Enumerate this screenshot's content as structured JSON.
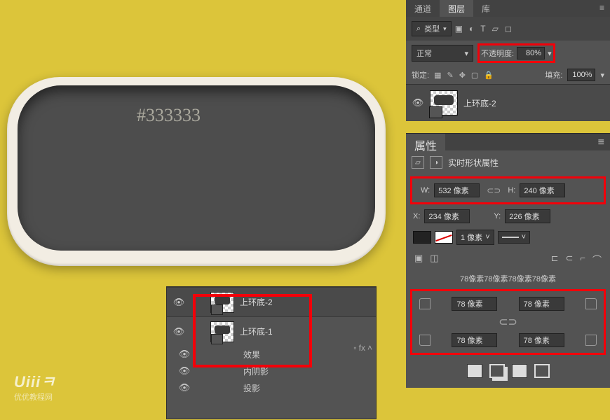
{
  "canvas": {
    "hex": "#333333"
  },
  "watermark": {
    "logo": "Uiiiㅋ",
    "sub": "优优教程网"
  },
  "layers_panel": {
    "tabs": {
      "channels": "通道",
      "layers": "图层",
      "libraries": "库"
    },
    "filter": {
      "label": "类型"
    },
    "blend": {
      "mode": "正常",
      "opacity_label": "不透明度:",
      "opacity_value": "80%"
    },
    "lock": {
      "label": "锁定:",
      "fill_label": "填充:",
      "fill_value": "100%"
    },
    "layer": {
      "name": "上环底-2"
    }
  },
  "layers_mini": {
    "row1": "上环底-2",
    "row2": "上环底-1",
    "sub_effects": "效果",
    "sub_inner": "内阴影",
    "sub_drop": "投影"
  },
  "properties": {
    "tab": "属性",
    "title": "实时形状属性",
    "w_label": "W:",
    "w_value": "532 像素",
    "h_label": "H:",
    "h_value": "240 像素",
    "x_label": "X:",
    "x_value": "234 像素",
    "y_label": "Y:",
    "y_value": "226 像素",
    "stroke_width": "1 像素",
    "radius_summary": "78像素78像素78像素78像素",
    "corner_tl": "78 像素",
    "corner_tr": "78 像素",
    "corner_bl": "78 像素",
    "corner_br": "78 像素"
  }
}
